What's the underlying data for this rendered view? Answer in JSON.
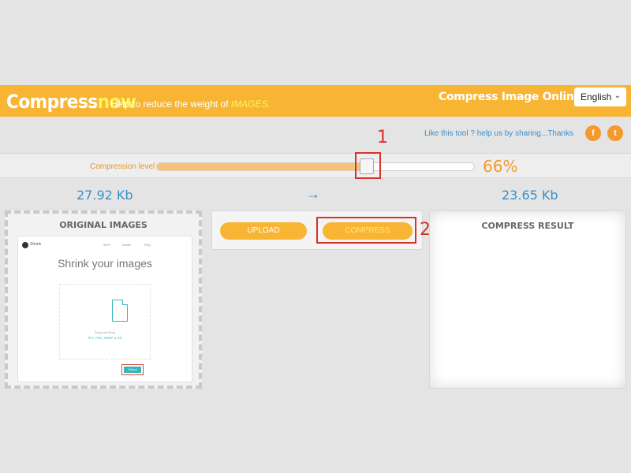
{
  "header": {
    "logo_part1": "Compress",
    "logo_part2": "now",
    "tagline_prefix": "Help to reduce the weight of",
    "tagline_highlight": "IMAGES.",
    "site_title": "Compress Image Online",
    "language": "English"
  },
  "share": {
    "text": "Like this tool ? help us by sharing...Thanks",
    "facebook_glyph": "f",
    "twitter_glyph": "t"
  },
  "slider": {
    "label": "Compression level",
    "value_percent": 66,
    "value_text": "66%"
  },
  "sizes": {
    "original": "27.92 Kb",
    "arrow": "→",
    "result": "23.65 Kb"
  },
  "original_panel": {
    "title": "ORIGINAL IMAGES",
    "preview": {
      "logo_text": "Shrink",
      "nav": [
        "WHY",
        "WHAT",
        "FAQ"
      ],
      "headline": "Shrink your images",
      "drop_text": "Drag and Drop",
      "formats_text": "JPG, PNG, WEBP & GIF",
      "select_label": "Select"
    }
  },
  "actions": {
    "upload_label": "UPLOAD",
    "compress_label": "COMPRESS"
  },
  "result_panel": {
    "title": "COMPRESS RESULT"
  },
  "annotations": {
    "step1": "1",
    "step2": "2",
    "color": "#d9322b"
  },
  "colors": {
    "brand_orange": "#f8b533",
    "accent_blue": "#3a8fc9",
    "teal": "#35b6bd"
  },
  "icons": {
    "facebook": "facebook-icon",
    "twitter": "twitter-icon",
    "language_chevron": "chevron-down-icon",
    "file": "file-icon"
  }
}
